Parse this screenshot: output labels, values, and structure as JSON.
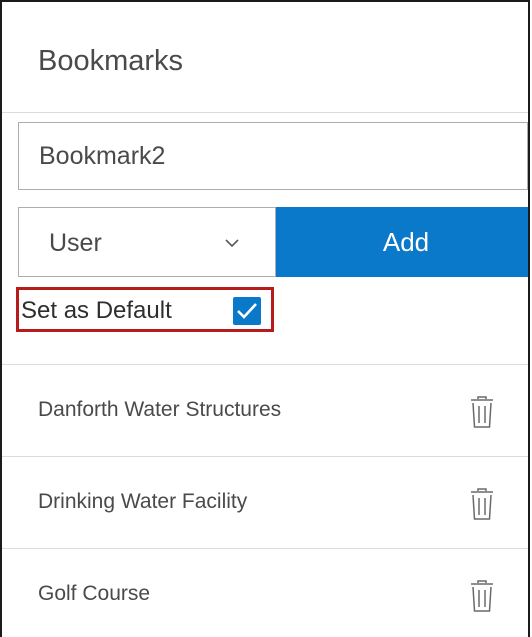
{
  "panel": {
    "title": "Bookmarks"
  },
  "form": {
    "name_input_value": "Bookmark2",
    "scope_select_value": "User",
    "add_label": "Add",
    "default_label": "Set as Default",
    "default_checked": true
  },
  "bookmarks": {
    "items": [
      {
        "label": "Danforth Water Structures",
        "icon": "trash-icon"
      },
      {
        "label": "Drinking Water Facility",
        "icon": "trash-icon"
      },
      {
        "label": "Golf Course",
        "icon": "trash-icon"
      }
    ]
  },
  "colors": {
    "accent": "#0a79c9",
    "highlight_border": "#b71c1c",
    "text": "#4a4a4a",
    "divider": "#dcdcdc"
  },
  "icons": {
    "select_chevron": "chevron-down-icon",
    "checkbox": "checkmark-icon",
    "delete": "trash-icon"
  }
}
